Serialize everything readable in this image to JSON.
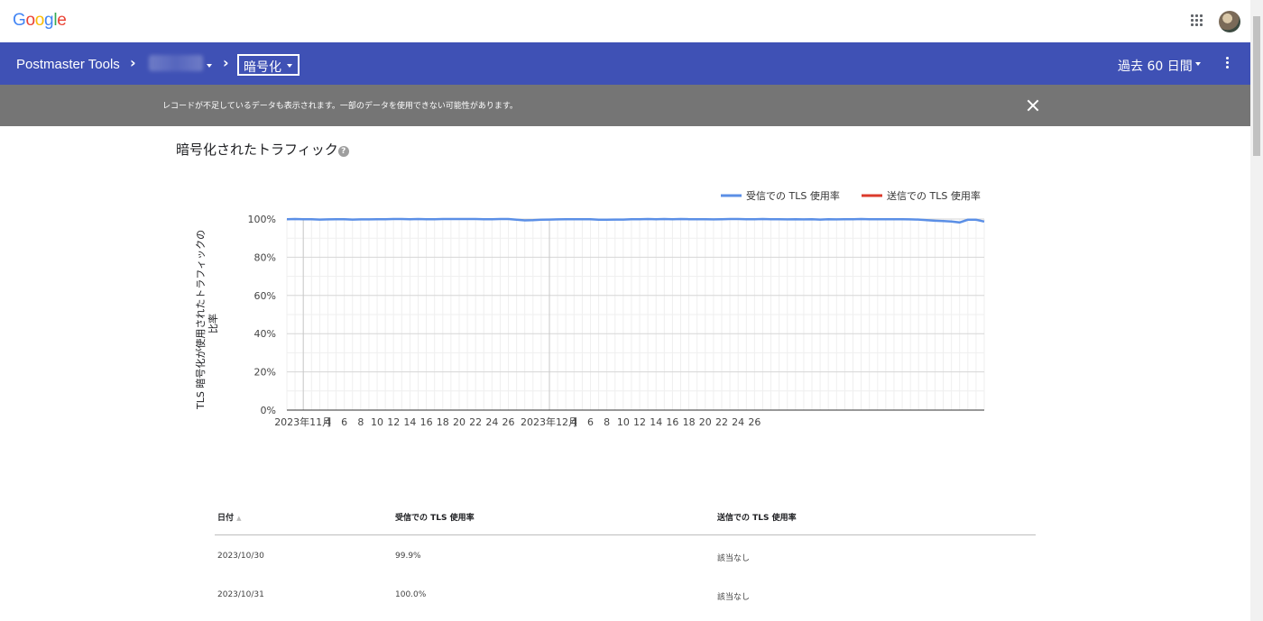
{
  "header": {
    "google_logo": "Google",
    "apps_icon": "apps-grid-icon",
    "avatar": "user-avatar"
  },
  "nav": {
    "title": "Postmaster Tools",
    "section_select": "暗号化",
    "period_select": "過去 60 日間",
    "menu_icon": "more-vert-icon"
  },
  "banner": {
    "message": "レコードが不足しているデータも表示されます。一部のデータを使用できない可能性があります。",
    "close_icon": "close-icon"
  },
  "section": {
    "title": "暗号化されたトラフィック"
  },
  "chart_data": {
    "type": "line",
    "ylabel": "TLS 暗号化が使用されたトラフィックの比率",
    "ylim": [
      0,
      100
    ],
    "y_ticks": [
      "0%",
      "20%",
      "40%",
      "60%",
      "80%",
      "100%"
    ],
    "x_ticks": [
      "2023年11月",
      "4",
      "6",
      "8",
      "10",
      "12",
      "14",
      "16",
      "18",
      "20",
      "22",
      "24",
      "26",
      "2023年12月",
      "4",
      "6",
      "8",
      "10",
      "12",
      "14",
      "16",
      "18",
      "20",
      "22",
      "24",
      "26"
    ],
    "legend_position": "top-right",
    "series": [
      {
        "name": "受信での TLS 使用率",
        "color": "#5b8fe6",
        "values": [
          99.9,
          100,
          99.9,
          99.9,
          99.7,
          99.8,
          99.9,
          99.9,
          99.7,
          99.8,
          99.8,
          99.9,
          99.9,
          100,
          100,
          99.9,
          100,
          99.9,
          99.9,
          100,
          100,
          100,
          100,
          100,
          99.9,
          99.9,
          100,
          100,
          99.6,
          99.3,
          99.4,
          99.6,
          99.7,
          99.8,
          99.9,
          99.9,
          99.9,
          99.9,
          99.6,
          99.6,
          99.7,
          99.7,
          99.9,
          99.9,
          100,
          99.9,
          100,
          99.9,
          100,
          99.9,
          99.9,
          99.9,
          99.8,
          99.9,
          100,
          100,
          99.9,
          99.9,
          100,
          99.9,
          99.9,
          99.8,
          99.9,
          99.8,
          99.9,
          99.7,
          99.9,
          99.8,
          99.9,
          99.9,
          100,
          99.9,
          99.9,
          99.9,
          99.9,
          99.9,
          99.8,
          99.7,
          99.4,
          99.1,
          98.9,
          98.7,
          98.2,
          99.6,
          99.6,
          98.7
        ]
      },
      {
        "name": "送信での TLS 使用率",
        "color": "#db3a2b",
        "values": []
      }
    ]
  },
  "table": {
    "headers": [
      "日付",
      "受信での TLS 使用率",
      "送信での TLS 使用率"
    ],
    "sort_icon": "sort-ascending-icon",
    "rows": [
      [
        "2023/10/30",
        "99.9%",
        "該当なし"
      ],
      [
        "2023/10/31",
        "100.0%",
        "該当なし"
      ]
    ]
  }
}
